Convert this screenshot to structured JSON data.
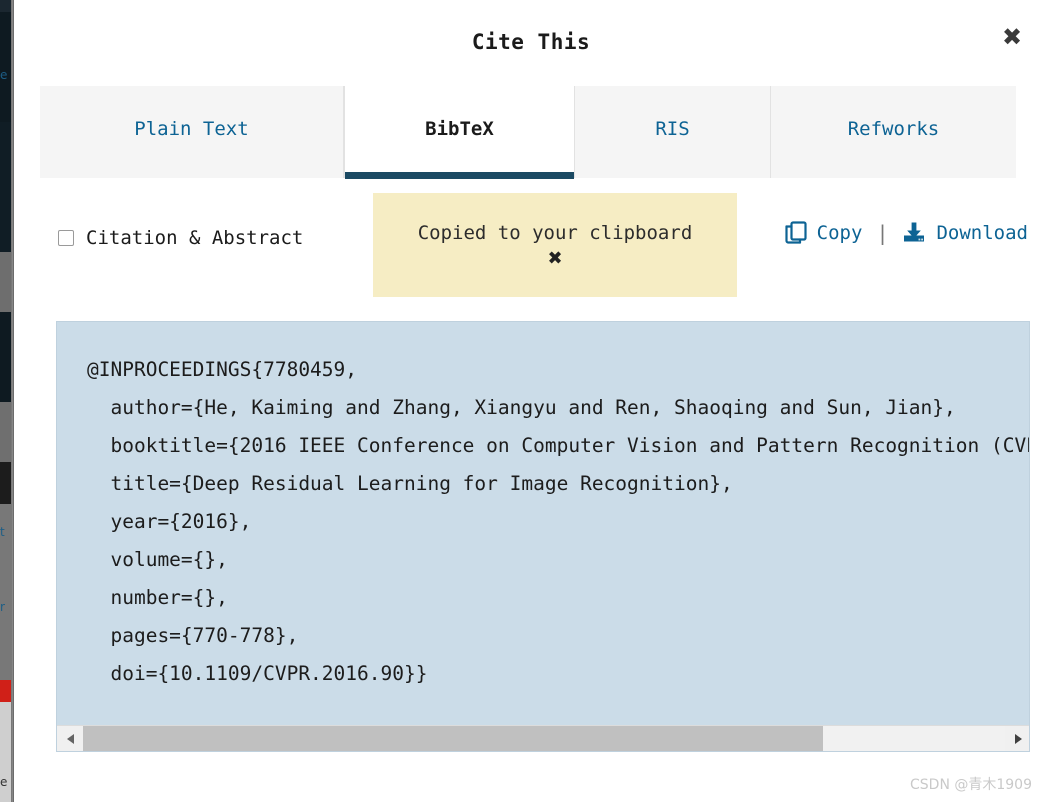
{
  "dialog": {
    "title": "Cite This",
    "close_label": "✖"
  },
  "tabs": [
    {
      "label": "Plain Text",
      "active": false
    },
    {
      "label": "BibTeX",
      "active": true
    },
    {
      "label": "RIS",
      "active": false
    },
    {
      "label": "Refworks",
      "active": false
    }
  ],
  "options": {
    "citation_abstract_label": "Citation & Abstract",
    "citation_abstract_checked": false
  },
  "toast": {
    "message": "Copied to your clipboard",
    "close_label": "✖",
    "background": "#f6edc4"
  },
  "actions": {
    "copy_label": "Copy",
    "copy_icon": "copy-icon",
    "separator": "|",
    "download_label": "Download",
    "download_icon": "download-icon"
  },
  "citation": {
    "format": "BibTeX",
    "background": "#cbdce8",
    "text": "@INPROCEEDINGS{7780459,\n  author={He, Kaiming and Zhang, Xiangyu and Ren, Shaoqing and Sun, Jian},\n  booktitle={2016 IEEE Conference on Computer Vision and Pattern Recognition (CVPR)},\n  title={Deep Residual Learning for Image Recognition},\n  year={2016},\n  volume={},\n  number={},\n  pages={770-778},\n  doi={10.1109/CVPR.2016.90}}",
    "scroll_left_arrow": "◀",
    "scroll_right_arrow": "▶"
  },
  "watermark": "CSDN @青木1909",
  "colors": {
    "link_blue": "#0d6394",
    "active_tab_underline": "#1b4a63",
    "tabbar_bg": "#f5f5f5",
    "citation_bg": "#cbdce8",
    "toast_bg": "#f6edc4"
  }
}
